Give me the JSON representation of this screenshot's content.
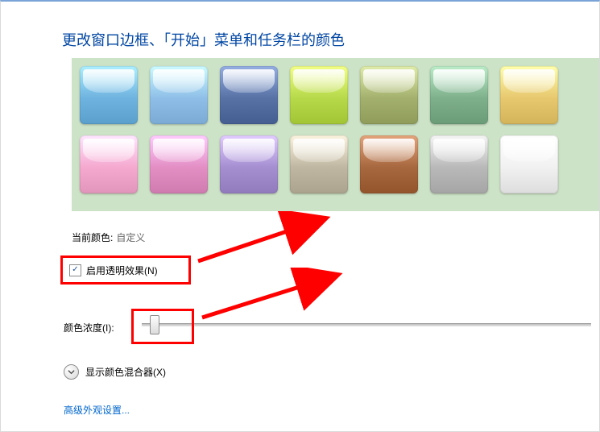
{
  "title": "更改窗口边框、「开始」菜单和任务栏的颜色",
  "swatches_row1": [
    "#6fb3e0",
    "#8fbfe8",
    "#5872a6",
    "#b6d94a",
    "#a3b06e",
    "#7fb08c",
    "#e7c86f"
  ],
  "swatches_row2": [
    "#f5a9cf",
    "#e38fc4",
    "#a58fd1",
    "#bfb7a1",
    "#a7683f",
    "#b9b9b9",
    "#f1f1f1"
  ],
  "current": {
    "label": "当前颜色:",
    "value": "自定义"
  },
  "transparency": {
    "label": "启用透明效果(N)",
    "checked": true
  },
  "intensity": {
    "label": "颜色浓度(I):",
    "value": 8
  },
  "mixer_label": "显示颜色混合器(X)",
  "advanced_link": "高级外观设置..."
}
